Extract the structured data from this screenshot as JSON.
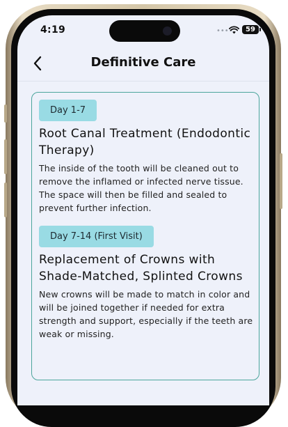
{
  "status_bar": {
    "time": "4:19",
    "signal_icon": "••••",
    "battery_level": "59"
  },
  "nav": {
    "title": "Definitive Care"
  },
  "sections": [
    {
      "badge": "Day 1-7",
      "title": "Root Canal Treatment (Endodontic Therapy)",
      "body": "The inside of the tooth will be cleaned out to remove the inflamed or infected nerve tissue. The space will then be filled and sealed to prevent further infection."
    },
    {
      "badge": "Day 7-14 (First Visit)",
      "title": "Replacement of Crowns with Shade-Matched, Splinted Crowns",
      "body": "New crowns will be made to match in color and will be joined together if needed for extra strength and support, especially if the teeth are weak or missing."
    }
  ],
  "colors": {
    "screen_bg": "#eef1fa",
    "card_border": "#4ba59c",
    "badge_bg": "#99dbe4",
    "frame_gold": "#d4c6a8"
  }
}
